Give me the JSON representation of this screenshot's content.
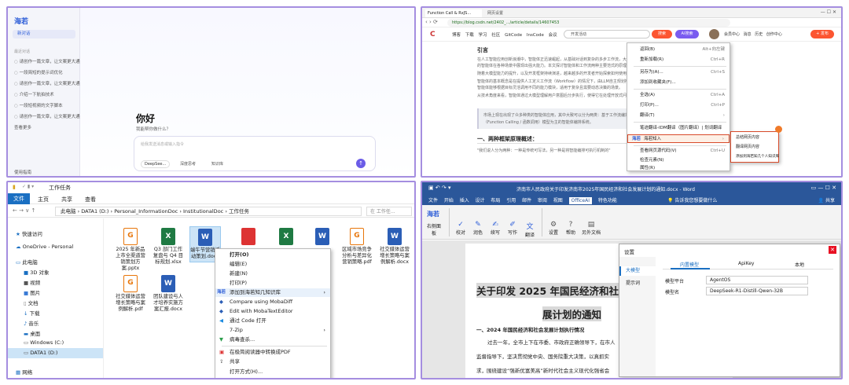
{
  "p1": {
    "logo": "海若",
    "new_chat": "新对话",
    "recent_label": "最近对话",
    "history": [
      "请创作一篇文章，让文案更大通用",
      "一段简短的提示词优化",
      "请创作一篇文章，让文案更大通用",
      "介绍一下航拍技术",
      "一段短视频的文字脚本",
      "请创作一篇文章，让文案更大通用"
    ],
    "more": "查看更多",
    "bottom": "使用指南",
    "greet": "你好",
    "sub": "我能帮你做什么？",
    "placeholder": "给我发送消息或输入指令",
    "model": "DeepSee...",
    "deep": "深度思考",
    "kb": "知识库"
  },
  "p2": {
    "tabs": [
      "Function Call & RxJS...",
      "网页设置"
    ],
    "url": "https://blog.csdn.net/2402_.../article/details/14607453",
    "nav": [
      "博客",
      "下载",
      "学习",
      "社区",
      "GitCode",
      "InsCode",
      "会议"
    ],
    "search": "开发活动",
    "btn_search": "搜索",
    "btn_ai": "AI搜索",
    "user_links": [
      "会员中心",
      "消息",
      "历史",
      "创作中心"
    ],
    "publish": "+ 发布",
    "heading1": "引言",
    "para": [
      "在人工智能应用创新浪潮中，智能体正迅速崛起，从基础对话到复杂的多步工作流，大型语言模型（LLM）驱动",
      "的智能体在各种场景中展现出强大能力。本文探讨智能体和工作流两种主要范式的原理与适用场景。",
      "随着大模型能力的提升，以及开发框架持续演进，越来越多的开发者开始探索如何使用智能体解决实际业务问题。",
      "智能体的基本概念是在提供人工定义工作流（Workflow）的情况下，由LLM自主规划推理步骤并选择工具完成任务，",
      "智能体能够根据目标灵活调用不同的能力模块，适用于复杂且需要动态决策的场景。",
      "从技术角度来看，智能体通过大模型理解用户意图后分步执行，使得它在处理开放式问题时表现更为出色。"
    ],
    "quote": "市场上现在出现了众多种类的智能体应用，其中大致可以分为两类：基于工作流编排的智能体和基于函数调用",
    "quote2": "（Function Calling / 函数调用）模型为主的智能体编排系统。",
    "heading2": "一、两种框架原理概述：",
    "last": "\"我们说人分为两种：一种是传统可写法，另一种是将智能编排可执行机制的\"",
    "menu": [
      {
        "label": "返回(B)",
        "key": "Alt+向左键"
      },
      {
        "label": "重新加载(R)",
        "key": "Ctrl+R"
      },
      {
        "label": "另存为(A)...",
        "key": "Ctrl+S"
      },
      {
        "label": "添加到收藏夹(F)...",
        "key": ""
      },
      {
        "label": "全选(A)",
        "key": "Ctrl+A"
      },
      {
        "label": "打印(P)...",
        "key": "Ctrl+P"
      },
      {
        "label": "翻译(T)",
        "key": ""
      },
      {
        "label": "笔迹翻译-IDM翻译（图片翻译）| 划词翻译",
        "key": ""
      },
      {
        "label": "海若知入",
        "key": ""
      },
      {
        "label": "查看网页源代码(V)",
        "key": "Ctrl+U"
      },
      {
        "label": "检查元素(N)",
        "key": ""
      },
      {
        "label": "属性(R)",
        "key": ""
      }
    ],
    "submenu": [
      "总结网页内容",
      "翻译网页内容",
      "添加到海若知几个人知识库"
    ]
  },
  "p3": {
    "title": "工作任务",
    "tabs": [
      "文件",
      "主页",
      "共享",
      "查看"
    ],
    "path": [
      "此电脑",
      "DATA1 (D:)",
      "Personal_InformationDoc",
      "InstitutionalDoc",
      "工作任务"
    ],
    "search": "在 工作任...",
    "nav": [
      "快速访问",
      "OneDrive - Personal",
      "此电脑",
      "3D 对象",
      "视频",
      "图片",
      "文档",
      "下载",
      "音乐",
      "桌面",
      "Windows (C:)",
      "DATA1 (D:)",
      "网络"
    ],
    "files": [
      {
        "name": "2025 年新品上市全渠道营销策划方案.pptx",
        "type": "p"
      },
      {
        "name": "Q3 部门工作复盘与 Q4 目标规划.xlsx",
        "type": "x"
      },
      {
        "name": "端午节营销活动策划.docx",
        "type": "w"
      },
      {
        "name": "区域市场竞争分析与差异化营销策略.pdf",
        "type": "p"
      },
      {
        "name": "社交媒体运营增长策略与案例解析.docx",
        "type": "w"
      },
      {
        "name": "社交媒体运营增长策略与案例解析.pdf",
        "type": "p"
      },
      {
        "name": "团队建设与人才培养实施方案汇报.docx",
        "type": "w"
      }
    ],
    "menu": [
      "打开(O)",
      "编辑(E)",
      "新建(N)",
      "打印(P)",
      "添加到海若知几知识库",
      "Compare using MobaDiff",
      "Edit with MobaTextEditor",
      "通过 Code 打开",
      "7-Zip",
      "病毒查杀...",
      "在极简阅读器中转换成PDF",
      "共享",
      "打开方式(H)..."
    ]
  },
  "p4": {
    "title": "济南市人民政府关于印发济南市2025年国民经济和社会发展计划的通知.docx - Word",
    "tabs": [
      "文件",
      "开始",
      "插入",
      "设计",
      "布局",
      "引用",
      "邮件",
      "审阅",
      "视图",
      "OfficeAI",
      "特色功能"
    ],
    "tellme": "告诉我您想要做什么",
    "share": "共享",
    "ribbon": [
      "右侧面板",
      "校对",
      "润色",
      "续写",
      "写作",
      "翻译",
      "设置",
      "帮助",
      "另外文档"
    ],
    "doc_title1": "关于印发 2025 年国民经济和社会发",
    "doc_title2": "展计划的通知",
    "sec": "一、2024 年国民经济和社会发展计划执行情况",
    "lines": [
      "过去一年，全市上下在市委、市政府正确领导下，在市人",
      "监督指导下，坚决贯彻党中央、国务院重大决策，以真抓实",
      "求，围绕建设“强新优富美高”新时代社会主义现代化强省会"
    ],
    "dialog": {
      "title": "设置",
      "side": [
        "大模型",
        "提示词"
      ],
      "tabs": [
        "内置模型",
        "ApiKey",
        "本地"
      ],
      "labels": [
        "模型平台",
        "模型名"
      ],
      "values": [
        "AgentOS",
        "DeepSeek-R1-Distill-Qwen-32B"
      ]
    }
  }
}
